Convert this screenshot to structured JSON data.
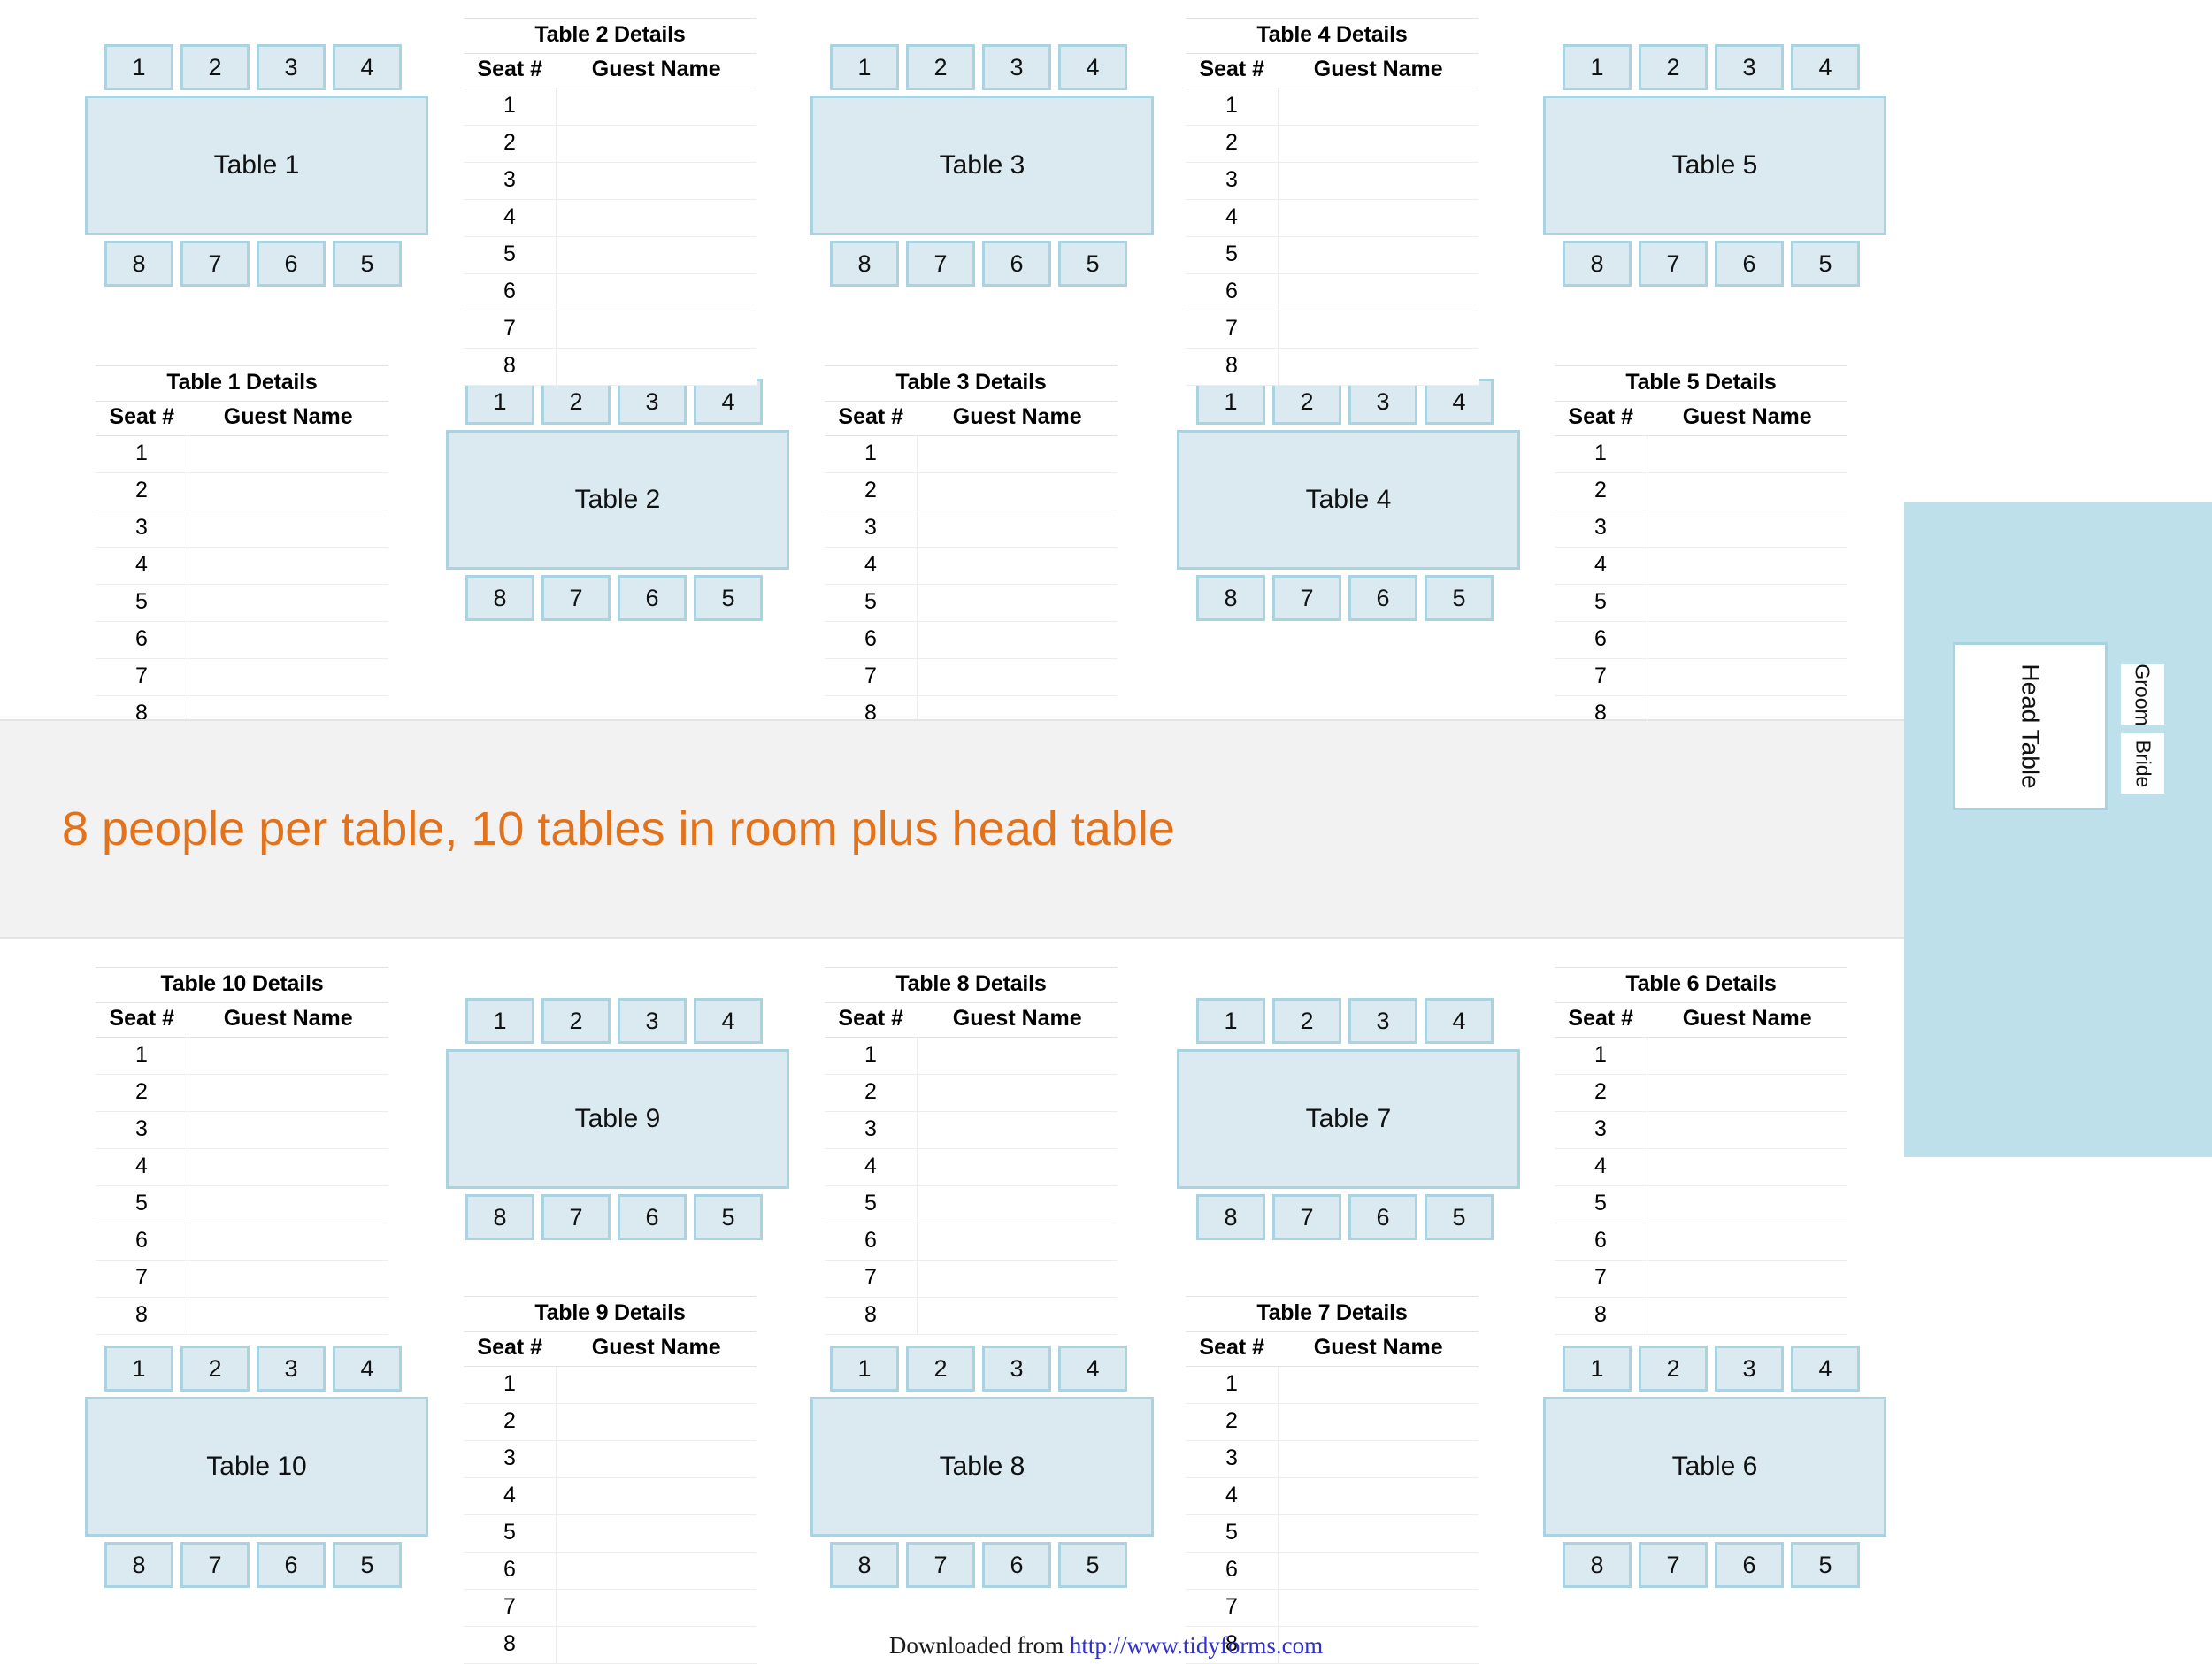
{
  "banner": {
    "text": "8 people per table, 10 tables in room plus head table",
    "text_color": "#e2721c",
    "background_color": "#f2f2f2"
  },
  "colors": {
    "table_fill": "#dbeaf1",
    "table_border": "#a9d3e1",
    "head_area_fill": "#bee0ea",
    "accent_orange": "#e2721c",
    "link_blue": "#3030cc"
  },
  "details_headers": {
    "seat_col": "Seat #",
    "name_col": "Guest Name"
  },
  "seat_numbers_top": [
    "1",
    "2",
    "3",
    "4"
  ],
  "seat_numbers_bottom": [
    "8",
    "7",
    "6",
    "5"
  ],
  "detail_rows": [
    "1",
    "2",
    "3",
    "4",
    "5",
    "6",
    "7",
    "8"
  ],
  "tables": [
    {
      "id": "t1",
      "label": "Table 1",
      "details_title": "Table 1 Details"
    },
    {
      "id": "t2",
      "label": "Table 2",
      "details_title": "Table 2 Details"
    },
    {
      "id": "t3",
      "label": "Table 3",
      "details_title": "Table 3 Details"
    },
    {
      "id": "t4",
      "label": "Table 4",
      "details_title": "Table 4 Details"
    },
    {
      "id": "t5",
      "label": "Table 5",
      "details_title": "Table 5 Details"
    },
    {
      "id": "t6",
      "label": "Table 6",
      "details_title": "Table 6 Details"
    },
    {
      "id": "t7",
      "label": "Table 7",
      "details_title": "Table 7 Details"
    },
    {
      "id": "t8",
      "label": "Table 8",
      "details_title": "Table 8 Details"
    },
    {
      "id": "t9",
      "label": "Table 9",
      "details_title": "Table 9 Details"
    },
    {
      "id": "t10",
      "label": "Table 10",
      "details_title": "Table 10 Details"
    }
  ],
  "head_table": {
    "label": "Head Table",
    "groom_label": "Groom",
    "bride_label": "Bride"
  },
  "footer": {
    "prefix": "Downloaded from ",
    "url": "http://www.tidyforms.com"
  }
}
